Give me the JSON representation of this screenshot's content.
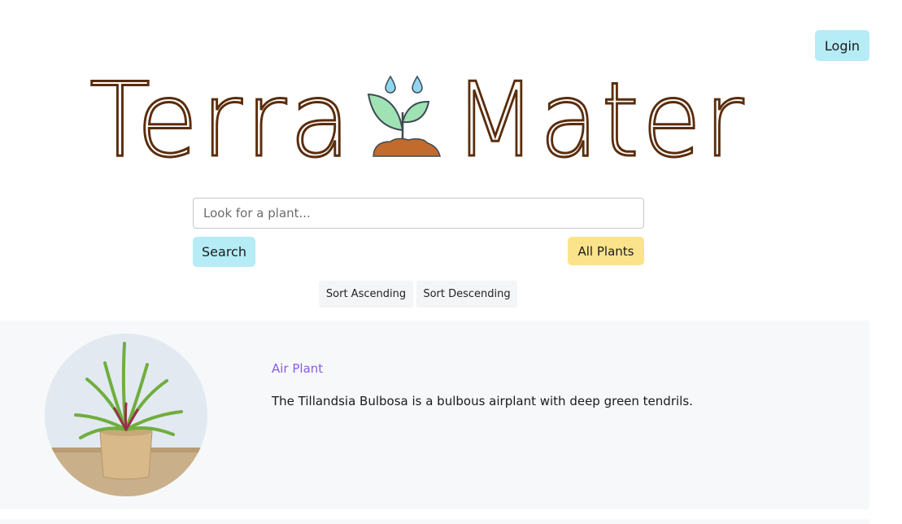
{
  "header": {
    "login_label": "Login"
  },
  "logo": {
    "text_left": "Terra",
    "text_right": "Mater",
    "colors": {
      "text": "#5a2d0c",
      "leaf": "#9fe3b5",
      "soil": "#c36a2d",
      "drop": "#8fd6ee"
    }
  },
  "search": {
    "placeholder": "Look for a plant...",
    "value": "",
    "button_label": "Search",
    "all_plants_label": "All Plants"
  },
  "sort": {
    "ascending_label": "Sort Ascending",
    "descending_label": "Sort Descending"
  },
  "plants": [
    {
      "name": "Air Plant",
      "description": "The Tillandsia Bulbosa is a bulbous airplant with deep green tendrils."
    }
  ],
  "colors": {
    "primary_button": "#b5ecf6",
    "secondary_button": "#fbe38c",
    "link": "#8a5ce6",
    "card_background": "#f7f8f9"
  }
}
